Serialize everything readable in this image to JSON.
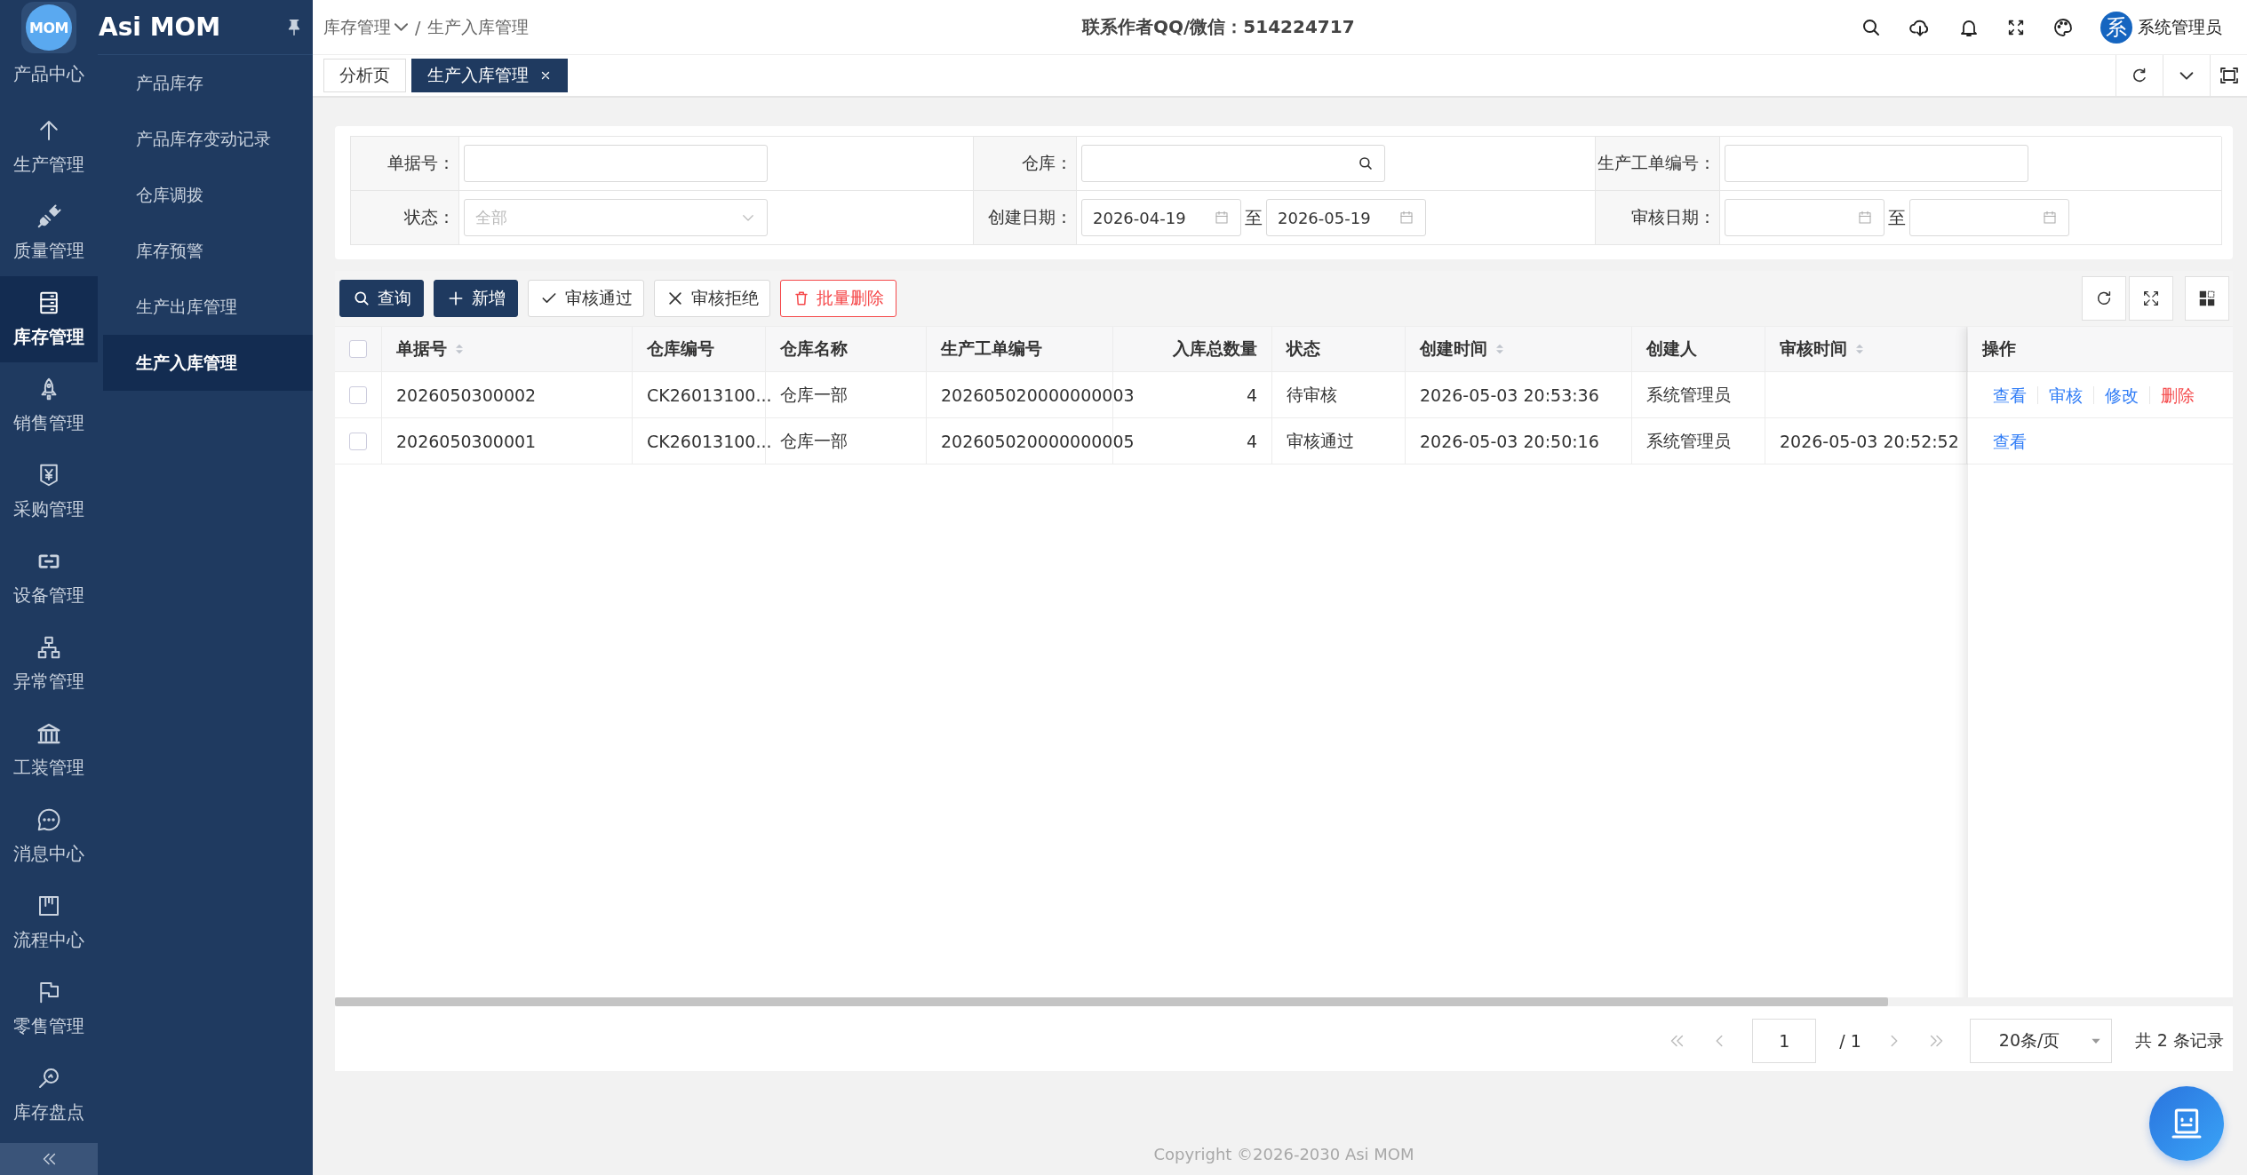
{
  "app": {
    "logo_text": "MOM",
    "name": "Asi MOM"
  },
  "rail": [
    {
      "label": "产品中心",
      "selected": false
    },
    {
      "label": "生产管理",
      "selected": false
    },
    {
      "label": "质量管理",
      "selected": false
    },
    {
      "label": "库存管理",
      "selected": true
    },
    {
      "label": "销售管理",
      "selected": false
    },
    {
      "label": "采购管理",
      "selected": false
    },
    {
      "label": "设备管理",
      "selected": false
    },
    {
      "label": "异常管理",
      "selected": false
    },
    {
      "label": "工装管理",
      "selected": false
    },
    {
      "label": "消息中心",
      "selected": false
    },
    {
      "label": "流程中心",
      "selected": false
    },
    {
      "label": "零售管理",
      "selected": false
    },
    {
      "label": "库存盘点",
      "selected": false
    }
  ],
  "submenu": [
    {
      "label": "产品库存",
      "selected": false
    },
    {
      "label": "产品库存变动记录",
      "selected": false
    },
    {
      "label": "仓库调拨",
      "selected": false
    },
    {
      "label": "库存预警",
      "selected": false
    },
    {
      "label": "生产出库管理",
      "selected": false
    },
    {
      "label": "生产入库管理",
      "selected": true
    }
  ],
  "breadcrumb": {
    "items": [
      "库存管理",
      "生产入库管理"
    ],
    "separator": "/"
  },
  "contact": "联系作者QQ/微信：514224717",
  "user": {
    "avatar": "系",
    "name": "系统管理员"
  },
  "tabs": [
    {
      "label": "分析页",
      "selected": false,
      "closable": false
    },
    {
      "label": "生产入库管理",
      "selected": true,
      "closable": true
    }
  ],
  "filters": [
    {
      "label": "单据号：",
      "kind": "text"
    },
    {
      "label": "仓库：",
      "kind": "search"
    },
    {
      "label": "生产工单编号：",
      "kind": "text"
    },
    {
      "label": "状态：",
      "kind": "select",
      "placeholder": "全部"
    },
    {
      "label": "创建日期：",
      "kind": "range",
      "from": "2026-04-19",
      "to": "2026-05-19",
      "separator": "至"
    },
    {
      "label": "审核日期：",
      "kind": "range",
      "separator": "至"
    }
  ],
  "actions": [
    {
      "label": "查询",
      "kind": "primary"
    },
    {
      "label": "新增",
      "kind": "primary"
    },
    {
      "label": "审核通过",
      "kind": "default"
    },
    {
      "label": "审核拒绝",
      "kind": "default"
    },
    {
      "label": "批量删除",
      "kind": "danger"
    }
  ],
  "table": {
    "all_selected": false,
    "columns": [
      {
        "label": "单据号",
        "sortable": true,
        "kind": "text"
      },
      {
        "label": "仓库编号",
        "sortable": false,
        "kind": "text"
      },
      {
        "label": "仓库名称",
        "sortable": false,
        "kind": "text"
      },
      {
        "label": "生产工单编号",
        "sortable": false,
        "kind": "text"
      },
      {
        "label": "入库总数量",
        "sortable": false,
        "kind": "number"
      },
      {
        "label": "状态",
        "sortable": false,
        "kind": "text"
      },
      {
        "label": "创建时间",
        "sortable": true,
        "kind": "text"
      },
      {
        "label": "创建人",
        "sortable": false,
        "kind": "text"
      },
      {
        "label": "审核时间",
        "sortable": true,
        "kind": "text"
      },
      {
        "label": "操作",
        "sortable": false
      }
    ],
    "rows": [
      {
        "selected": false,
        "doc_no": "2026050300002",
        "warehouse_code": "CK26013100...",
        "warehouse_name": "仓库一部",
        "work_order_no": "202605020000000003",
        "total_qty": "4",
        "status": "待审核",
        "created_at": "2026-05-03 20:53:36",
        "creator": "系统管理员",
        "actions": [
          {
            "label": "查看",
            "kind": "link"
          },
          {
            "label": "审核",
            "kind": "link"
          },
          {
            "label": "修改",
            "kind": "link"
          },
          {
            "label": "删除",
            "kind": "danger"
          }
        ]
      },
      {
        "selected": false,
        "doc_no": "2026050300001",
        "warehouse_code": "CK26013100...",
        "warehouse_name": "仓库一部",
        "work_order_no": "202605020000000005",
        "total_qty": "4",
        "status": "审核通过",
        "created_at": "2026-05-03 20:50:16",
        "creator": "系统管理员",
        "reviewed_at": "2026-05-03 20:52:52",
        "actions": [
          {
            "label": "查看",
            "kind": "link"
          }
        ]
      }
    ]
  },
  "pagination": {
    "page": "1",
    "total_pages": "/ 1",
    "page_size": "20条/页",
    "summary": "共 2 条记录"
  },
  "footer": "Copyright ©2026-2030 Asi MOM"
}
